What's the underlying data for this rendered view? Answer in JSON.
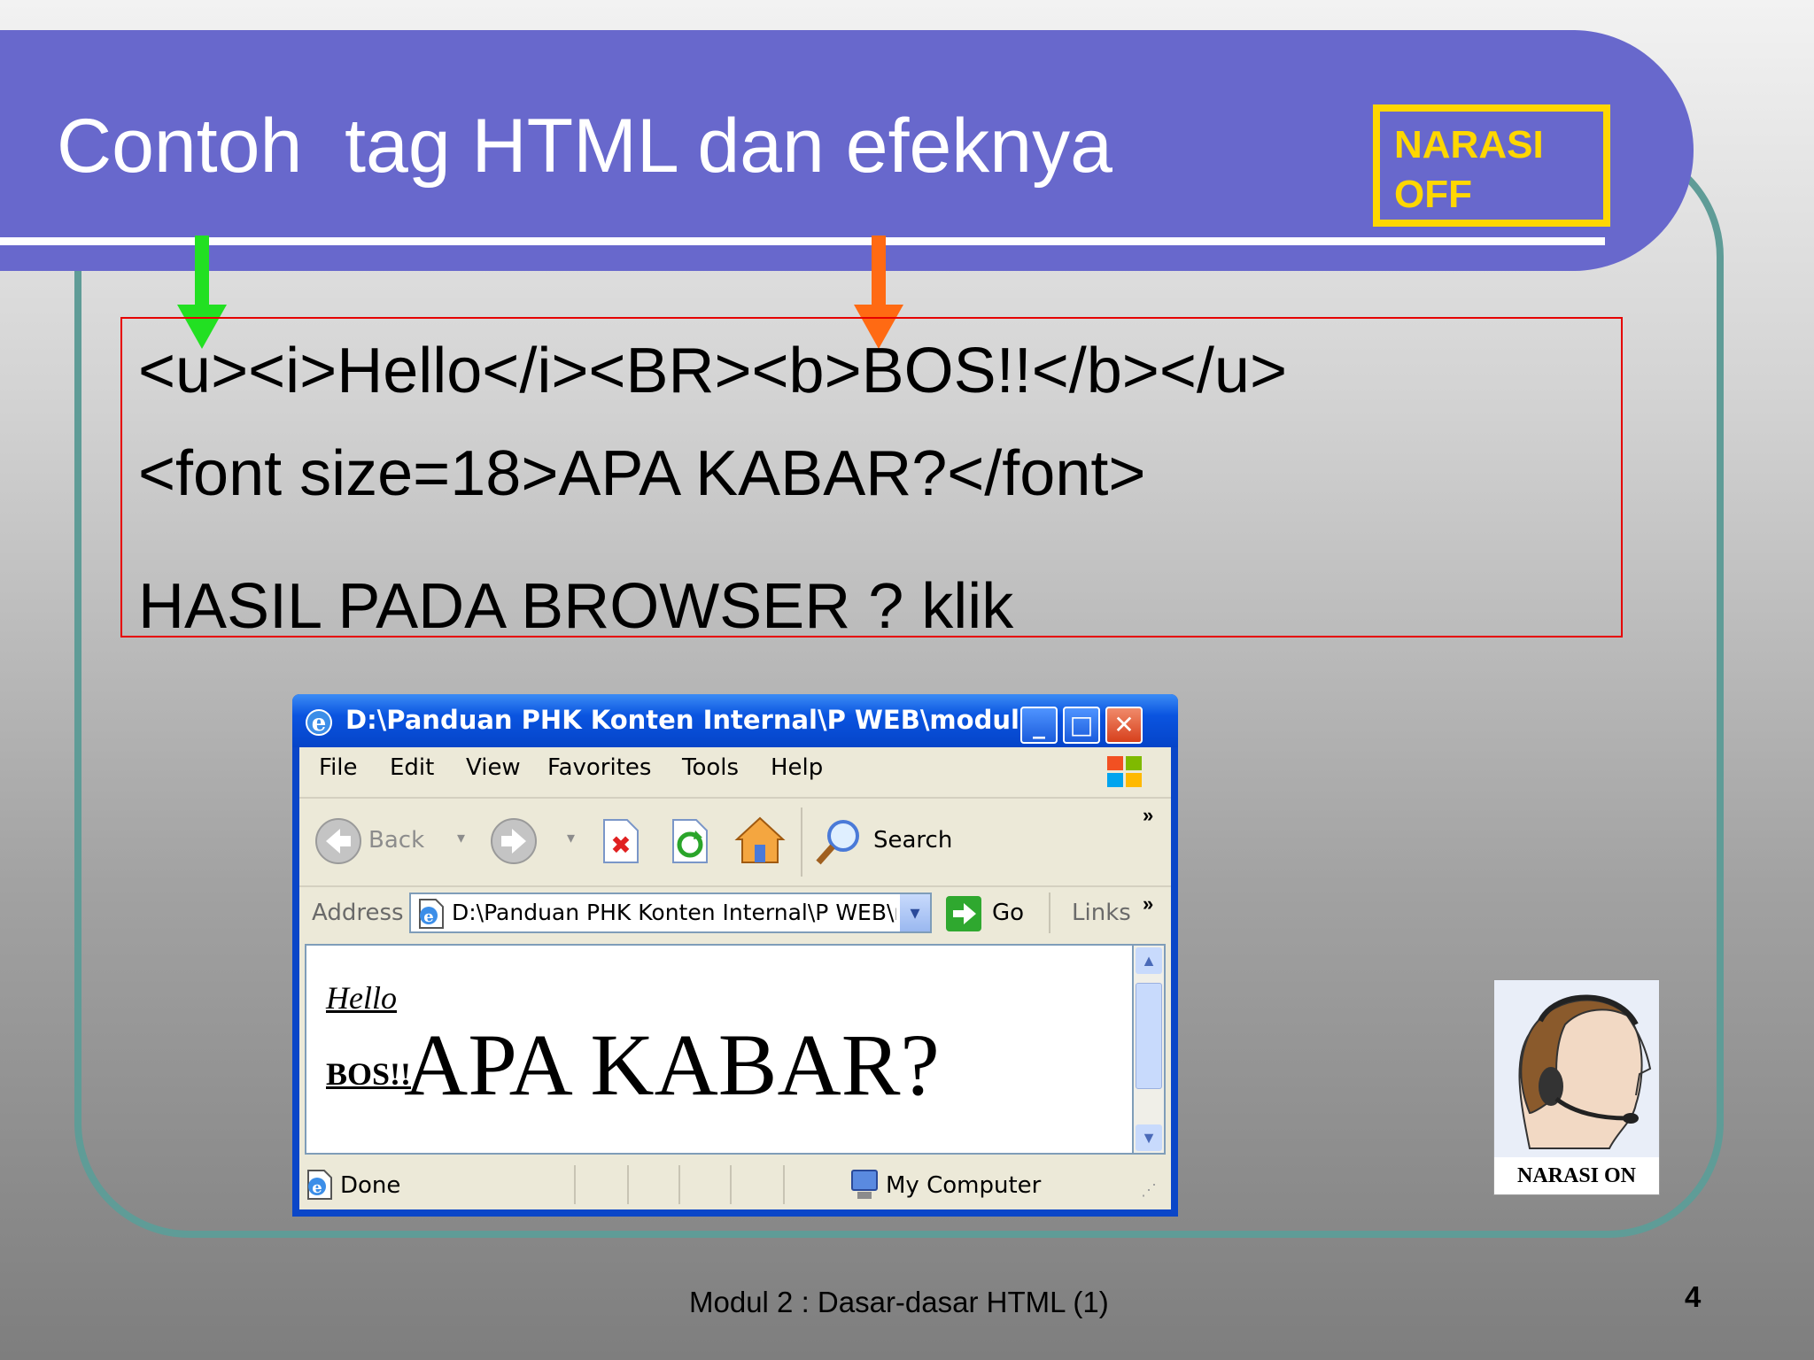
{
  "slide": {
    "title": "Contoh  tag HTML dan efeknya",
    "narasi_off": [
      "NARASI",
      "OFF"
    ],
    "code_lines": [
      "<u><i>Hello</i><BR><b>BOS!!</b></u>",
      "<font size=18>APA KABAR?</font>",
      "HASIL PADA BROWSER ? klik"
    ],
    "narasi_on_label": "NARASI ON",
    "footer": "Modul 2 : Dasar-dasar HTML (1)",
    "page_number": "4",
    "colors": {
      "banner": "#6868cc",
      "frame": "#5f9c97",
      "narasi_off": "#ffd700",
      "arrow_green": "#22e022",
      "arrow_orange": "#ff6a13",
      "code_border": "#e60000"
    }
  },
  "browser": {
    "window_title": "D:\\Panduan PHK Konten Internal\\P WEB\\modul...",
    "menu": [
      "File",
      "Edit",
      "View",
      "Favorites",
      "Tools",
      "Help"
    ],
    "toolbar": {
      "back": "Back",
      "search": "Search"
    },
    "address": {
      "label": "Address",
      "value": "D:\\Panduan PHK Konten Internal\\P WEB\\r",
      "go": "Go",
      "links": "Links"
    },
    "page": {
      "hello": "Hello",
      "bos": "BOS!!",
      "apa_kabar": "APA KABAR?"
    },
    "status": {
      "left": "Done",
      "zone": "My Computer"
    }
  }
}
